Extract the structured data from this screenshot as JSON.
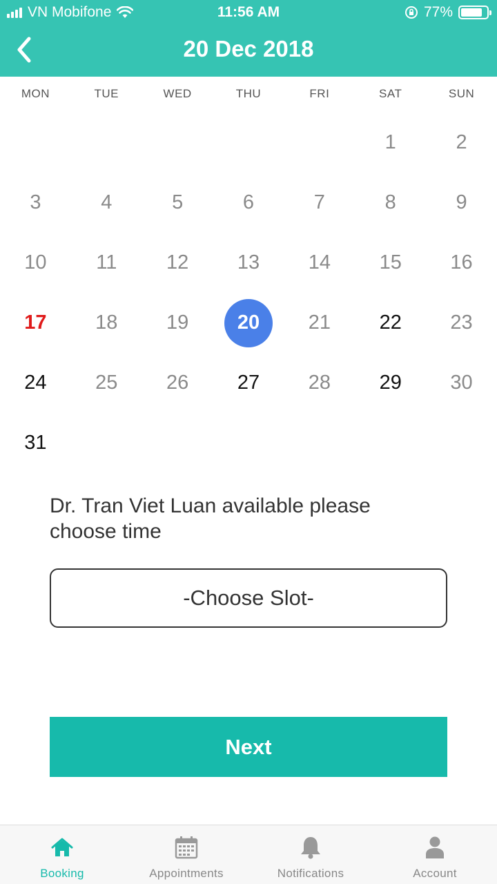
{
  "status_bar": {
    "carrier": "VN Mobifone",
    "time": "11:56 AM",
    "battery": "77%"
  },
  "header": {
    "title": "20 Dec 2018",
    "back_icon": "chevron-left-icon"
  },
  "calendar": {
    "weekdays": [
      "MON",
      "TUE",
      "WED",
      "THU",
      "FRI",
      "SAT",
      "SUN"
    ],
    "days": [
      "1",
      "2",
      "3",
      "4",
      "5",
      "6",
      "7",
      "8",
      "9",
      "10",
      "11",
      "12",
      "13",
      "14",
      "15",
      "16",
      "17",
      "18",
      "19",
      "20",
      "21",
      "22",
      "23",
      "24",
      "25",
      "26",
      "27",
      "28",
      "29",
      "30",
      "31"
    ],
    "selected_day": "20",
    "today_day": "17",
    "today_color": "#E01B1B",
    "selected_color": "#4A80E8"
  },
  "availability": {
    "message": "Dr. Tran Viet Luan available please choose time",
    "slot_label": "-Choose Slot-"
  },
  "actions": {
    "next_label": "Next"
  },
  "tabs": [
    {
      "label": "Booking",
      "icon": "home-icon",
      "active": true
    },
    {
      "label": "Appointments",
      "icon": "calendar-icon",
      "active": false
    },
    {
      "label": "Notifications",
      "icon": "bell-icon",
      "active": false
    },
    {
      "label": "Account",
      "icon": "user-icon",
      "active": false
    }
  ],
  "colors": {
    "header": "#36C4B3",
    "accent": "#17BAAB"
  }
}
